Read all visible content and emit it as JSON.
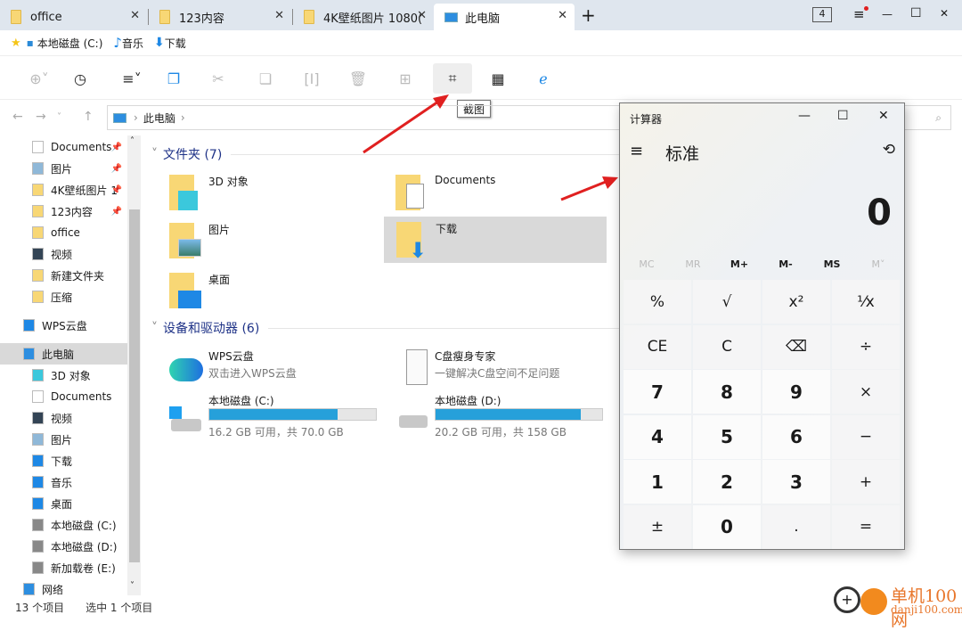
{
  "tabs": [
    {
      "label": "office"
    },
    {
      "label": "123内容"
    },
    {
      "label": "4K壁纸图片 1080("
    },
    {
      "label": "此电脑"
    }
  ],
  "window": {
    "tab_count": "4",
    "new_tab": "+",
    "menu": "≡",
    "minimize": "—",
    "maximize": "☐",
    "close": "✕"
  },
  "bookmarks": [
    {
      "label": "本地磁盘 (C:)"
    },
    {
      "label": "音乐"
    },
    {
      "label": "下载"
    }
  ],
  "toolbar": {
    "tooltip": "截图",
    "highlighted": "crop-screenshot"
  },
  "address": {
    "path": "此电脑"
  },
  "sidebar": {
    "items": [
      {
        "label": "Documents",
        "pinned": true
      },
      {
        "label": "图片",
        "pinned": true
      },
      {
        "label": "4K壁纸图片 1",
        "pinned": true
      },
      {
        "label": "123内容",
        "pinned": true
      },
      {
        "label": "office"
      },
      {
        "label": "视频"
      },
      {
        "label": "新建文件夹"
      },
      {
        "label": "压缩"
      },
      {
        "label": "WPS云盘"
      },
      {
        "label": "此电脑",
        "selected": true
      },
      {
        "label": "3D 对象"
      },
      {
        "label": "Documents"
      },
      {
        "label": "视频"
      },
      {
        "label": "图片"
      },
      {
        "label": "下载"
      },
      {
        "label": "音乐"
      },
      {
        "label": "桌面"
      },
      {
        "label": "本地磁盘 (C:)"
      },
      {
        "label": "本地磁盘 (D:)"
      },
      {
        "label": "新加载卷 (E:)"
      },
      {
        "label": "网络"
      }
    ]
  },
  "main": {
    "folders_header": "文件夹 (7)",
    "folders": [
      {
        "name": "3D 对象"
      },
      {
        "name": "Documents"
      },
      {
        "name": "图片"
      },
      {
        "name": "下载",
        "selected": true
      },
      {
        "name": "桌面"
      }
    ],
    "devices_header": "设备和驱动器 (6)",
    "devices": [
      {
        "name": "WPS云盘",
        "sub": "双击进入WPS云盘"
      },
      {
        "name": "C盘瘦身专家",
        "sub": "一键解决C盘空间不足问题"
      },
      {
        "name": "本地磁盘 (C:)",
        "sub": "16.2 GB 可用，共 70.0 GB",
        "used_percent": 77
      },
      {
        "name": "本地磁盘 (D:)",
        "sub": "20.2 GB 可用，共 158 GB",
        "used_percent": 87
      }
    ]
  },
  "status": {
    "count": "13 个项目",
    "selected": "选中 1 个项目"
  },
  "calculator": {
    "title": "计算器",
    "mode": "标准",
    "display": "0",
    "memory": [
      "MC",
      "MR",
      "M+",
      "M-",
      "MS",
      "M˅"
    ],
    "keys": [
      "%",
      "√",
      "x²",
      "¹⁄x",
      "CE",
      "C",
      "⌫",
      "÷",
      "7",
      "8",
      "9",
      "×",
      "4",
      "5",
      "6",
      "−",
      "1",
      "2",
      "3",
      "+",
      "±",
      "0",
      ".",
      "="
    ]
  },
  "watermark": {
    "text": "单机100网",
    "url": "danji100.com"
  },
  "colors": {
    "accent": "#26a0da",
    "arrow": "#e02020",
    "header": "#1e3287"
  }
}
